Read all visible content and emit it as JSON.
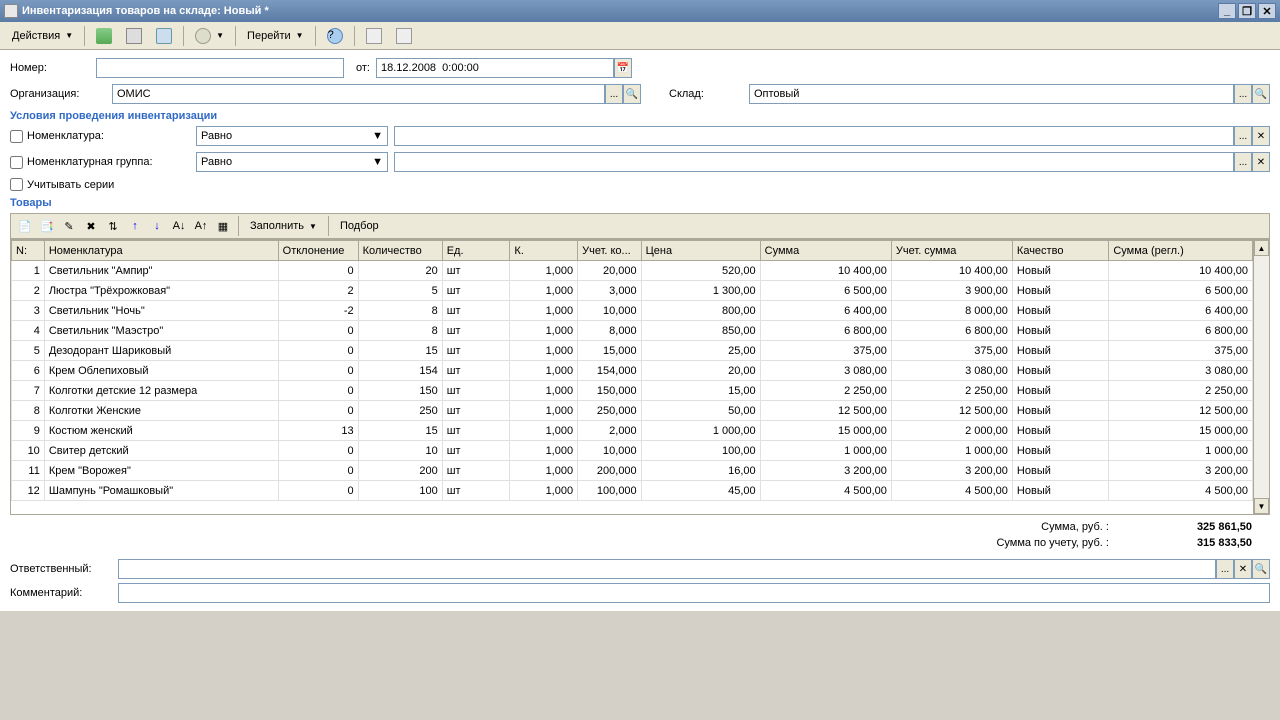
{
  "window": {
    "title": "Инвентаризация товаров на складе: Новый *"
  },
  "toolbar": {
    "actions": "Действия",
    "goto": "Перейти"
  },
  "form": {
    "number_label": "Номер:",
    "number_value": "",
    "from_label": "от:",
    "date_value": "18.12.2008  0:00:00",
    "org_label": "Организация:",
    "org_value": "ОМИС",
    "warehouse_label": "Склад:",
    "warehouse_value": "Оптовый"
  },
  "conditions": {
    "header": "Условия проведения инвентаризации",
    "nomenclature_label": "Номенклатура:",
    "nom_group_label": "Номенклатурная группа:",
    "equal": "Равно",
    "series_label": "Учитывать серии"
  },
  "items": {
    "header": "Товары",
    "fill_btn": "Заполнить",
    "pick_btn": "Подбор",
    "columns": [
      "N:",
      "Номенклатура",
      "Отклонение",
      "Количество",
      "Ед.",
      "К.",
      "Учет. ко...",
      "Цена",
      "Сумма",
      "Учет. сумма",
      "Качество",
      "Сумма (регл.)"
    ],
    "rows": [
      {
        "n": "1",
        "name": "Светильник \"Ампир\"",
        "dev": "0",
        "qty": "20",
        "unit": "шт",
        "k": "1,000",
        "uq": "20,000",
        "price": "520,00",
        "sum": "10 400,00",
        "usum": "10 400,00",
        "qual": "Новый",
        "rsum": "10 400,00"
      },
      {
        "n": "2",
        "name": "Люстра \"Трёхрожковая\"",
        "dev": "2",
        "qty": "5",
        "unit": "шт",
        "k": "1,000",
        "uq": "3,000",
        "price": "1 300,00",
        "sum": "6 500,00",
        "usum": "3 900,00",
        "qual": "Новый",
        "rsum": "6 500,00"
      },
      {
        "n": "3",
        "name": "Светильник \"Ночь\"",
        "dev": "-2",
        "qty": "8",
        "unit": "шт",
        "k": "1,000",
        "uq": "10,000",
        "price": "800,00",
        "sum": "6 400,00",
        "usum": "8 000,00",
        "qual": "Новый",
        "rsum": "6 400,00"
      },
      {
        "n": "4",
        "name": "Светильник \"Маэстро\"",
        "dev": "0",
        "qty": "8",
        "unit": "шт",
        "k": "1,000",
        "uq": "8,000",
        "price": "850,00",
        "sum": "6 800,00",
        "usum": "6 800,00",
        "qual": "Новый",
        "rsum": "6 800,00"
      },
      {
        "n": "5",
        "name": "Дезодорант Шариковый",
        "dev": "0",
        "qty": "15",
        "unit": "шт",
        "k": "1,000",
        "uq": "15,000",
        "price": "25,00",
        "sum": "375,00",
        "usum": "375,00",
        "qual": "Новый",
        "rsum": "375,00"
      },
      {
        "n": "6",
        "name": "Крем Облепиховый",
        "dev": "0",
        "qty": "154",
        "unit": "шт",
        "k": "1,000",
        "uq": "154,000",
        "price": "20,00",
        "sum": "3 080,00",
        "usum": "3 080,00",
        "qual": "Новый",
        "rsum": "3 080,00"
      },
      {
        "n": "7",
        "name": "Колготки детские 12 размера",
        "dev": "0",
        "qty": "150",
        "unit": "шт",
        "k": "1,000",
        "uq": "150,000",
        "price": "15,00",
        "sum": "2 250,00",
        "usum": "2 250,00",
        "qual": "Новый",
        "rsum": "2 250,00"
      },
      {
        "n": "8",
        "name": "Колготки Женские",
        "dev": "0",
        "qty": "250",
        "unit": "шт",
        "k": "1,000",
        "uq": "250,000",
        "price": "50,00",
        "sum": "12 500,00",
        "usum": "12 500,00",
        "qual": "Новый",
        "rsum": "12 500,00"
      },
      {
        "n": "9",
        "name": "Костюм женский",
        "dev": "13",
        "qty": "15",
        "unit": "шт",
        "k": "1,000",
        "uq": "2,000",
        "price": "1 000,00",
        "sum": "15 000,00",
        "usum": "2 000,00",
        "qual": "Новый",
        "rsum": "15 000,00"
      },
      {
        "n": "10",
        "name": "Свитер детский",
        "dev": "0",
        "qty": "10",
        "unit": "шт",
        "k": "1,000",
        "uq": "10,000",
        "price": "100,00",
        "sum": "1 000,00",
        "usum": "1 000,00",
        "qual": "Новый",
        "rsum": "1 000,00"
      },
      {
        "n": "11",
        "name": "Крем \"Ворожея\"",
        "dev": "0",
        "qty": "200",
        "unit": "шт",
        "k": "1,000",
        "uq": "200,000",
        "price": "16,00",
        "sum": "3 200,00",
        "usum": "3 200,00",
        "qual": "Новый",
        "rsum": "3 200,00"
      },
      {
        "n": "12",
        "name": "Шампунь \"Ромашковый\"",
        "dev": "0",
        "qty": "100",
        "unit": "шт",
        "k": "1,000",
        "uq": "100,000",
        "price": "45,00",
        "sum": "4 500,00",
        "usum": "4 500,00",
        "qual": "Новый",
        "rsum": "4 500,00"
      }
    ]
  },
  "totals": {
    "sum_label": "Сумма, руб. :",
    "sum_value": "325 861,50",
    "usum_label": "Сумма по учету, руб. :",
    "usum_value": "315 833,50"
  },
  "footer": {
    "resp_label": "Ответственный:",
    "comment_label": "Комментарий:"
  }
}
